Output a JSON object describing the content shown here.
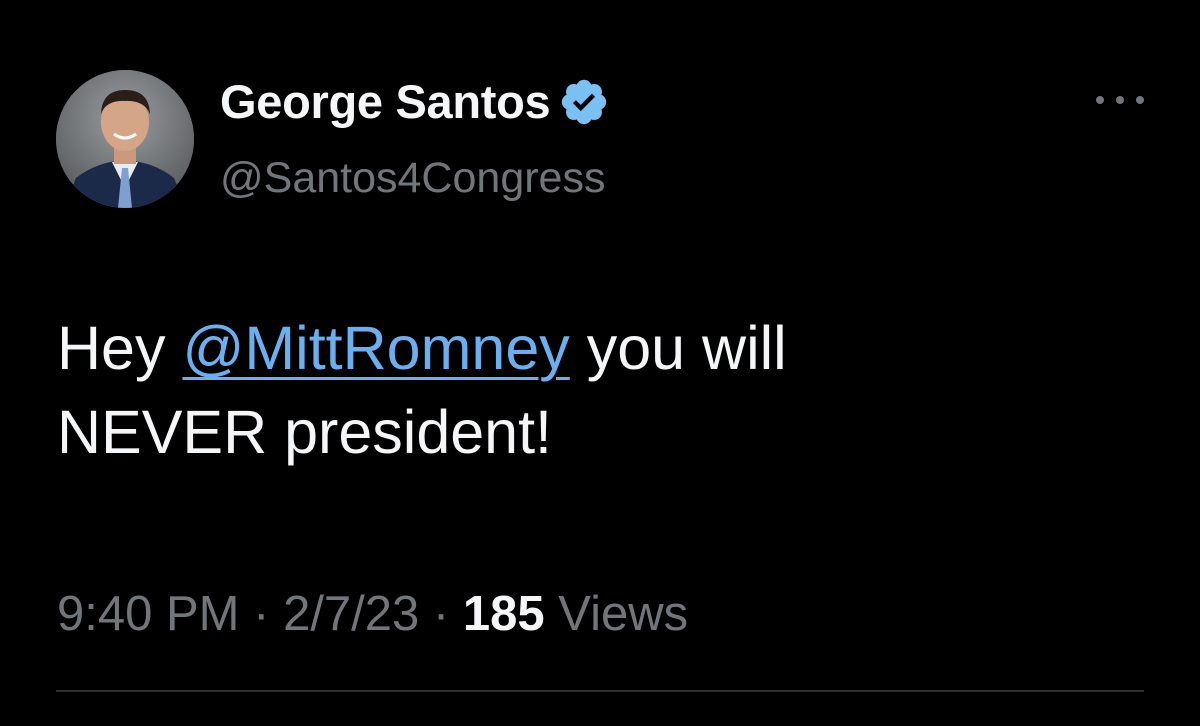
{
  "tweet": {
    "author": {
      "display_name": "George Santos",
      "handle": "@Santos4Congress",
      "verified": true,
      "verified_icon": "verified-badge-icon"
    },
    "text": {
      "before_mention": "Hey ",
      "mention": "@MittRomney",
      "after_mention": " you will",
      "line2": "NEVER president!"
    },
    "meta": {
      "time": "9:40 PM",
      "separator": "·",
      "date": "2/7/23",
      "views_count": "185",
      "views_label": "Views"
    },
    "more_icon": "more-horizontal-icon"
  },
  "colors": {
    "background": "#000000",
    "primary_text": "#f4f6f8",
    "secondary_text": "#71767b",
    "link": "#6ab0f0",
    "verified_blue": "#7bc0f2",
    "divider": "#2f3336"
  }
}
